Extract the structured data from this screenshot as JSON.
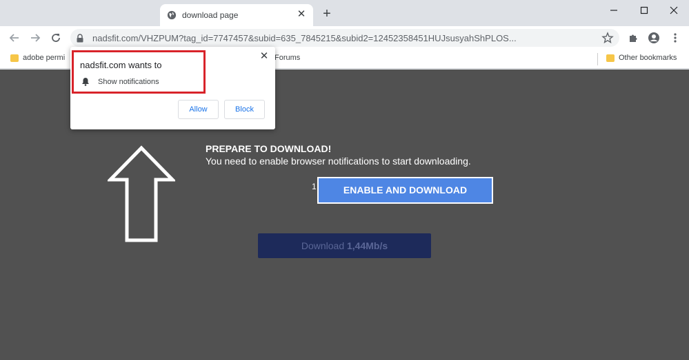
{
  "tab": {
    "title": "download page",
    "close_symbol": "✕",
    "new_tab_symbol": "+"
  },
  "window_controls": {
    "minimize": "minimize-icon",
    "maximize": "maximize-icon",
    "close": "close-icon"
  },
  "toolbar": {
    "url": "nadsfit.com/VHZPUM?tag_id=7747457&subid=635_7845215&subid2=12452358451HUJsusyahShPLOS..."
  },
  "bookmarks": {
    "items": [
      {
        "label": "adobe permi"
      },
      {
        "label": "Forums"
      }
    ],
    "other_label": "Other bookmarks"
  },
  "permission_prompt": {
    "title": "nadsfit.com wants to",
    "permission": "Show notifications",
    "allow_label": "Allow",
    "block_label": "Block",
    "close_symbol": "✕",
    "highlight_color": "#d8232a"
  },
  "page": {
    "heading": "PREPARE TO DOWNLOAD!",
    "subtext": "You need to enable browser notifications to start downloading.",
    "stray_char": "1",
    "enable_button": "ENABLE AND DOWNLOAD",
    "download_prefix": "Download ",
    "download_speed": "1,44Mb/s",
    "background_color": "#515151",
    "button_color": "#4e86e4"
  }
}
